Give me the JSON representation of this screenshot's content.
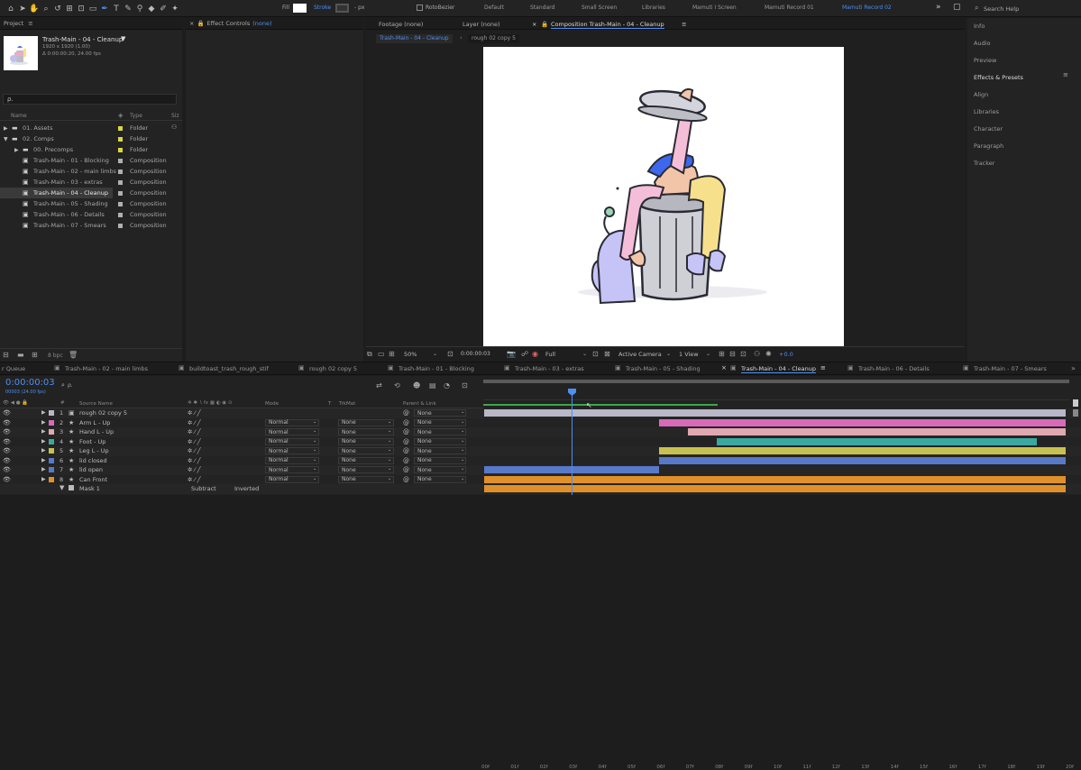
{
  "toolbar": {
    "fill_label": "Fill",
    "stroke_label": "Stroke",
    "stroke_value": "- px",
    "rotobezier_label": "RotoBezier",
    "workspaces": [
      "Default",
      "Standard",
      "Small Screen",
      "Libraries",
      "Mamuti I Screen",
      "Mamuti Record 01",
      "Mamuti Record 02"
    ],
    "active_workspace": "Mamuti Record 02",
    "search_placeholder": "Search Help"
  },
  "project": {
    "panel_title": "Project",
    "comp_name": "Trash-Main - 04 - Cleanup",
    "comp_res": "1920 x 1920 (1.00)",
    "comp_duration": "Δ 0:00:00:20, 24.00 fps",
    "col_name": "Name",
    "col_type": "Type",
    "col_size": "Siz",
    "bpc": "8 bpc",
    "items": [
      {
        "name": "01. Assets",
        "type": "Folder",
        "indent": 0,
        "kind": "folder",
        "color": "#d8d840"
      },
      {
        "name": "02. Comps",
        "type": "Folder",
        "indent": 0,
        "kind": "folder",
        "color": "#d8d840",
        "open": true
      },
      {
        "name": "00. Precomps",
        "type": "Folder",
        "indent": 1,
        "kind": "folder",
        "color": "#d8d840"
      },
      {
        "name": "Trash-Main - 01 - Blocking",
        "type": "Composition",
        "indent": 1,
        "kind": "comp",
        "color": "#b0b0b0"
      },
      {
        "name": "Trash-Main - 02 - main limbs",
        "type": "Composition",
        "indent": 1,
        "kind": "comp",
        "color": "#b0b0b0"
      },
      {
        "name": "Trash-Main - 03 - extras",
        "type": "Composition",
        "indent": 1,
        "kind": "comp",
        "color": "#b0b0b0"
      },
      {
        "name": "Trash-Main - 04 - Cleanup",
        "type": "Composition",
        "indent": 1,
        "kind": "comp",
        "color": "#b0b0b0",
        "selected": true
      },
      {
        "name": "Trash-Main - 05 - Shading",
        "type": "Composition",
        "indent": 1,
        "kind": "comp",
        "color": "#b0b0b0"
      },
      {
        "name": "Trash-Main - 06 - Details",
        "type": "Composition",
        "indent": 1,
        "kind": "comp",
        "color": "#b0b0b0"
      },
      {
        "name": "Trash-Main - 07 - Smears",
        "type": "Composition",
        "indent": 1,
        "kind": "comp",
        "color": "#b0b0b0"
      }
    ]
  },
  "effects": {
    "title": "Effect Controls",
    "value": "(none)"
  },
  "viewer": {
    "footage_tab": "Footage (none)",
    "layer_tab": "Layer (none)",
    "comp_tab": "Composition Trash-Main - 04 - Cleanup",
    "crumb1": "Trash-Main - 04 - Cleanup",
    "crumb2": "rough 02 copy 5",
    "zoom": "50%",
    "timecode": "0:00:00:03",
    "resolution": "Full",
    "camera": "Active Camera",
    "views": "1 View",
    "exposure": "+0.0"
  },
  "right_panels": [
    "Info",
    "Audio",
    "Preview",
    "Effects & Presets",
    "Align",
    "Libraries",
    "Character",
    "Paragraph",
    "Tracker"
  ],
  "timeline": {
    "tabs": [
      "r Queue",
      "Trash-Main - 02 - main limbs",
      "buildtoast_trash_rough_stif",
      "rough 02 copy 5",
      "Trash-Main - 01 - Blocking",
      "Trash-Main - 03 - extras",
      "Trash-Main - 05 - Shading",
      "Trash-Main - 04 - Cleanup",
      "Trash-Main - 06 - Details",
      "Trash-Main - 07 - Smears"
    ],
    "active_tab": "Trash-Main - 04 - Cleanup",
    "timecode": "0:00:00:03",
    "timecode_sub": "00003 (24.00 fps)",
    "search_placeholder": "ρ.",
    "col_source": "Source Name",
    "col_mode": "Mode",
    "col_t": "T",
    "col_trkmat": "TrkMat",
    "col_parent": "Parent & Link",
    "ticks": [
      "00f",
      "01f",
      "02f",
      "03f",
      "04f",
      "05f",
      "06f",
      "07f",
      "08f",
      "09f",
      "10f",
      "11f",
      "12f",
      "13f",
      "14f",
      "15f",
      "16f",
      "17f",
      "18f",
      "19f",
      "20f"
    ],
    "layers": [
      {
        "num": "1",
        "name": "rough 02 copy 5",
        "mode": "",
        "trkmat": "",
        "parent": "None",
        "color": "#b8b8c8",
        "star": false,
        "start": 0.0,
        "end": 1.0
      },
      {
        "num": "2",
        "name": "Arm L - Up",
        "mode": "Normal",
        "trkmat": "None",
        "parent": "None",
        "color": "#d86ab8",
        "star": true,
        "start": 0.3,
        "end": 1.0
      },
      {
        "num": "3",
        "name": "Hand L - Up",
        "mode": "Normal",
        "trkmat": "None",
        "parent": "None",
        "color": "#e0a8b0",
        "star": true,
        "start": 0.35,
        "end": 1.0
      },
      {
        "num": "4",
        "name": "Foot - Up",
        "mode": "Normal",
        "trkmat": "None",
        "parent": "None",
        "color": "#3aa8a0",
        "star": true,
        "start": 0.4,
        "end": 0.95
      },
      {
        "num": "5",
        "name": "Leg L - Up",
        "mode": "Normal",
        "trkmat": "None",
        "parent": "None",
        "color": "#c8c050",
        "star": true,
        "start": 0.3,
        "end": 1.0
      },
      {
        "num": "6",
        "name": "lid closed",
        "mode": "Normal",
        "trkmat": "None",
        "parent": "None",
        "color": "#5878c8",
        "star": true,
        "start": 0.3,
        "end": 1.0
      },
      {
        "num": "7",
        "name": "lid open",
        "mode": "Normal",
        "trkmat": "None",
        "parent": "None",
        "color": "#5878c8",
        "star": true,
        "start": 0.0,
        "end": 0.3
      },
      {
        "num": "8",
        "name": "Can Front",
        "mode": "Normal",
        "trkmat": "None",
        "parent": "None",
        "color": "#e0902a",
        "star": true,
        "start": 0.0,
        "end": 1.0
      }
    ],
    "mask_name": "Mask 1",
    "mask_mode": "Subtract",
    "mask_inverted": "Inverted"
  },
  "colors": {
    "accent": "#4d8ff2",
    "panel": "#232323",
    "bg": "#1d1d1d"
  }
}
